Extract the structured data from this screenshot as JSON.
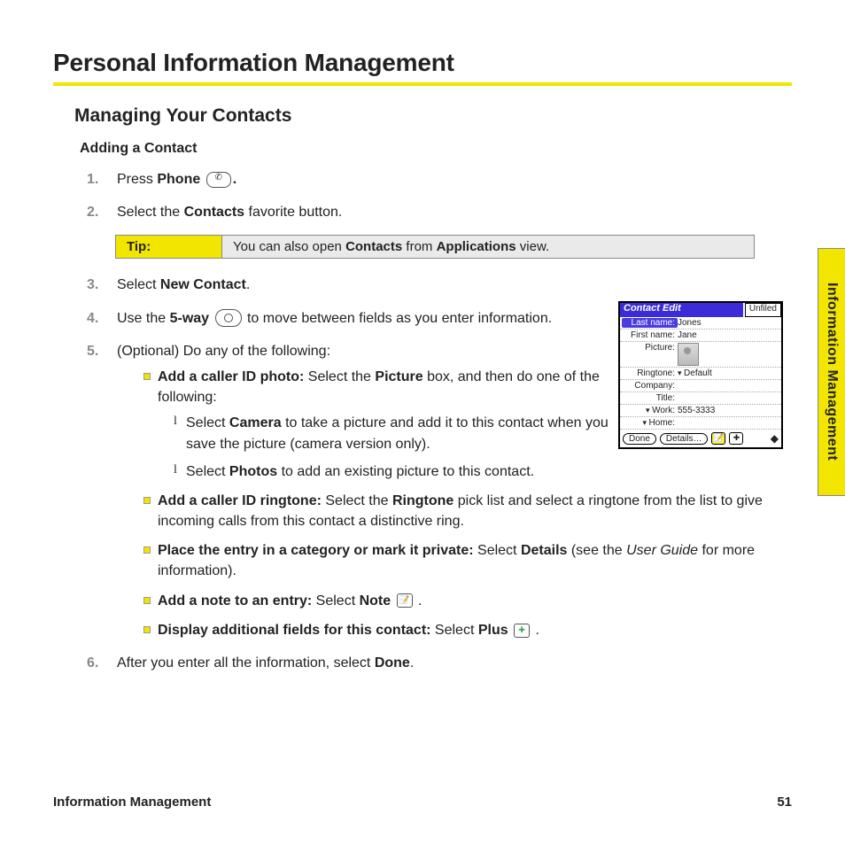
{
  "title": "Personal Information Management",
  "section": "Managing Your Contacts",
  "subsection": "Adding a Contact",
  "tip": {
    "label": "Tip:",
    "text_pre": "You can also open ",
    "b1": "Contacts",
    "mid": " from ",
    "b2": "Applications",
    "post": " view."
  },
  "steps": {
    "s1": {
      "pre": "Press ",
      "b": "Phone",
      "post": "."
    },
    "s2": {
      "pre": "Select the ",
      "b": "Contacts",
      "post": " favorite button."
    },
    "s3": {
      "pre": "Select ",
      "b": "New Contact",
      "post": "."
    },
    "s4": {
      "pre": "Use the ",
      "b": "5-way",
      "post": " to move between fields as you enter information."
    },
    "s5": {
      "pre": "(Optional) Do any of the following:"
    },
    "s6": {
      "pre": "After you enter all the information, select ",
      "b": "Done",
      "post": "."
    }
  },
  "sub": {
    "a": {
      "b": "Add a caller ID photo:",
      "t": " Select the ",
      "b2": "Picture",
      "t2": " box, and then do one of the following:"
    },
    "a1": {
      "pre": "Select ",
      "b": "Camera",
      "post": " to take a picture and add it to this contact when you save the picture (camera version only)."
    },
    "a2": {
      "pre": "Select ",
      "b": "Photos",
      "post": " to add an existing picture to this contact."
    },
    "b_": {
      "b": "Add a caller ID ringtone:",
      "t": " Select the ",
      "b2": "Ringtone",
      "t2": " pick list and select a ringtone from the list to give incoming calls from this contact a distinctive ring."
    },
    "c": {
      "b": "Place the entry in a category or mark it private:",
      "t": " Select ",
      "b2": "Details",
      "t2": " (see the ",
      "i": "User Guide",
      "t3": " for more information)."
    },
    "d": {
      "b": "Add a note to an entry:",
      "t": " Select ",
      "b2": "Note",
      "t2": " ."
    },
    "e": {
      "b": "Display additional fields for this contact:",
      "t": " Select ",
      "b2": "Plus",
      "t2": " ."
    }
  },
  "device": {
    "title": "Contact Edit",
    "category": "Unfiled",
    "lastname_lbl": "Last name:",
    "lastname": "Jones",
    "firstname_lbl": "First name:",
    "firstname": "Jane",
    "picture_lbl": "Picture:",
    "ringtone_lbl": "Ringtone:",
    "ringtone": "Default",
    "company_lbl": "Company:",
    "title_lbl": "Title:",
    "work_lbl": "Work:",
    "work": "555-3333",
    "home_lbl": "Home:",
    "done": "Done",
    "details": "Details…"
  },
  "sidetab": "Information Management",
  "footer": {
    "left": "Information Management",
    "right": "51"
  }
}
